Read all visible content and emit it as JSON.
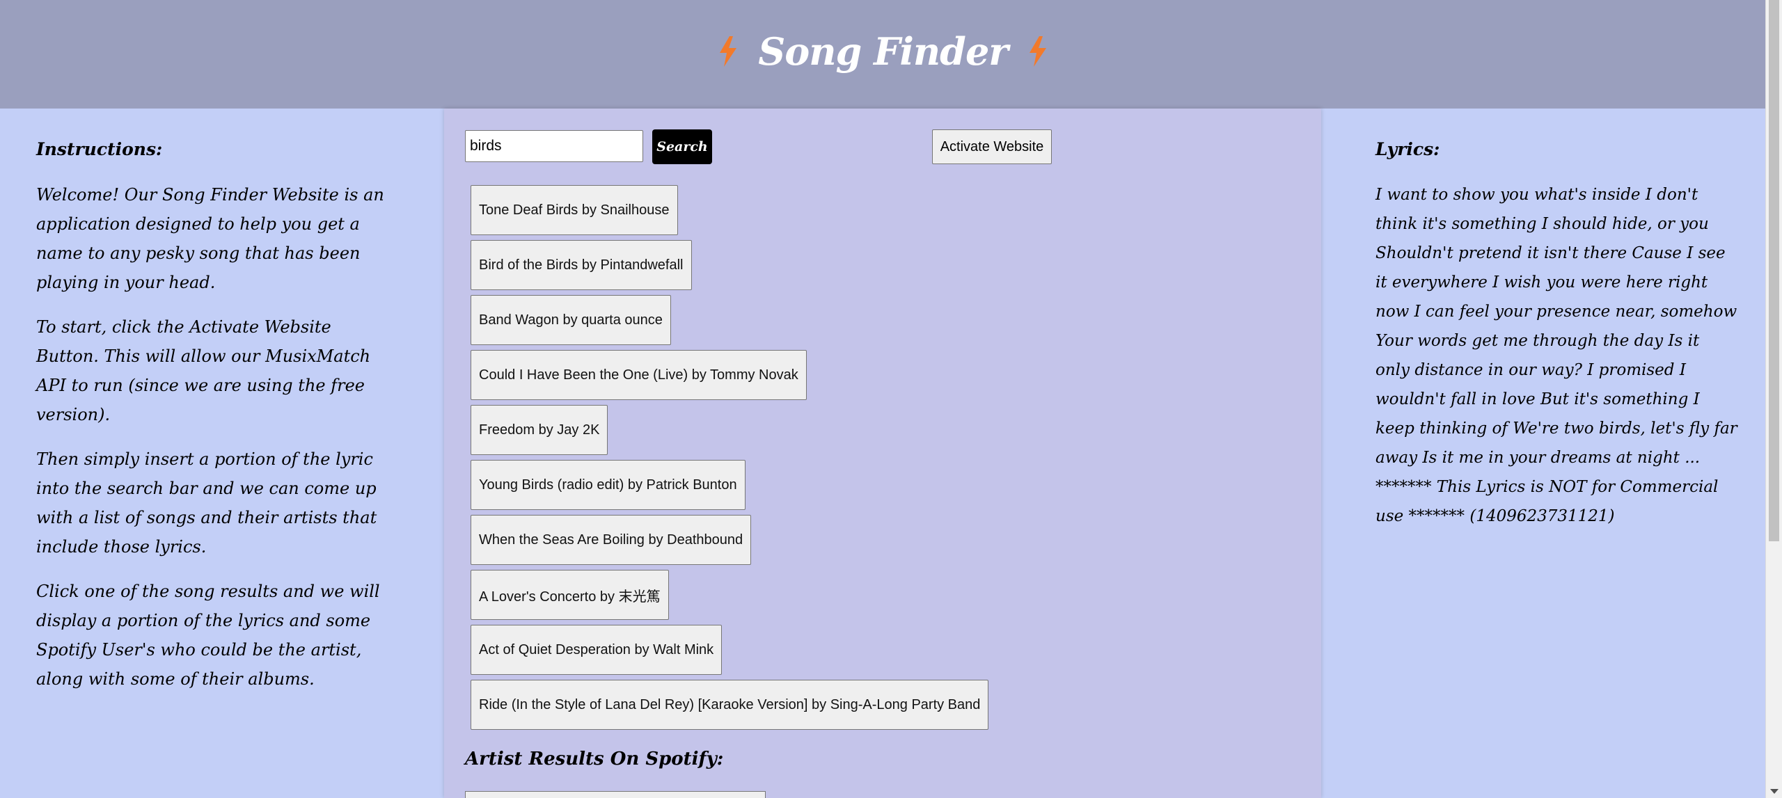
{
  "header": {
    "title": "Song Finder",
    "accent_color": "#f27a2b",
    "left_icon": "lightning-bolt-icon",
    "right_icon": "lightning-bolt-icon"
  },
  "instructions": {
    "heading": "Instructions:",
    "paragraphs": [
      "Welcome! Our Song Finder Website is an application designed to help you get a name to any pesky song that has been playing in your head.",
      "To start, click the Activate Website Button. This will allow our MusixMatch API to run (since we are using the free version).",
      "Then simply insert a portion of the lyric into the search bar and we can come up with a list of songs and their artists that include those lyrics.",
      "Click one of the song results and we will display a portion of the lyrics and some Spotify User's who could be the artist, along with some of their albums."
    ]
  },
  "search": {
    "value": "birds",
    "button_label": "Search"
  },
  "activate": {
    "label": "Activate Website"
  },
  "results": [
    "Tone Deaf Birds by Snailhouse",
    "Bird of the Birds by Pintandwefall",
    "Band Wagon by quarta ounce",
    "Could I Have Been the One (Live) by Tommy Novak",
    "Freedom by Jay 2K",
    "Young Birds (radio edit) by Patrick Bunton",
    "When the Seas Are Boiling by Deathbound",
    "A Lover's Concerto by 末光篤",
    "Act of Quiet Desperation by Walt Mink",
    "Ride (In the Style of Lana Del Rey) [Karaoke Version] by Sing-A-Long Party Band"
  ],
  "artist_results": {
    "heading": "Artist Results On Spotify:"
  },
  "lyrics": {
    "heading": "Lyrics:",
    "text": "I want to show you what's inside I don't think it's something I should hide, or you Shouldn't pretend it isn't there Cause I see it everywhere I wish you were here right now I can feel your presence near, somehow Your words get me through the day Is it only distance in our way? I promised I wouldn't fall in love But it's something I keep thinking of We're two birds, let's fly far away Is it me in your dreams at night ... ******* This Lyrics is NOT for Commercial use ******* (1409623731121)"
  }
}
